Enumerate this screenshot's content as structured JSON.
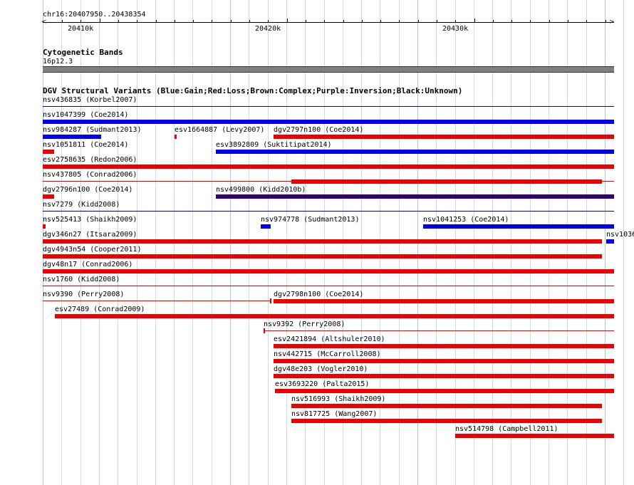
{
  "ruler": {
    "location": "chr16:20407950..20438354",
    "labels": [
      "20410k",
      "20420k",
      "20430k"
    ]
  },
  "cytoband": {
    "title": "Cytogenetic Bands",
    "band": "16p12.3"
  },
  "dgv": {
    "title": "DGV Structural Variants (Blue:Gain;Red:Loss;Brown:Complex;Purple:Inversion;Black:Unknown)",
    "colors": {
      "gain": "#0000ee",
      "loss": "#ee0000",
      "inversion": "#330077",
      "band": "#808080"
    },
    "features": [
      {
        "label": "nsv436835 (Korbel2007)"
      },
      {
        "label": "nsv1047399 (Coe2014)"
      },
      {
        "label": "nsv984287 (Sudmant2013)"
      },
      {
        "label": "esv1664887 (Levy2007)"
      },
      {
        "label": "dgv2797n100 (Coe2014)"
      },
      {
        "label": "nsv1051811 (Coe2014)"
      },
      {
        "label": "esv3892809 (Suktitipat2014)"
      },
      {
        "label": "esv2758635 (Redon2006)"
      },
      {
        "label": "nsv437805 (Conrad2006)"
      },
      {
        "label": "dgv2796n100 (Coe2014)"
      },
      {
        "label": "nsv499800 (Kidd2010b)"
      },
      {
        "label": "nsv7279 (Kidd2008)"
      },
      {
        "label": "nsv525413 (Shaikh2009)"
      },
      {
        "label": "nsv974778 (Sudmant2013)"
      },
      {
        "label": "nsv1041253 (Coe2014)"
      },
      {
        "label": "dgv346n27 (Itsara2009)"
      },
      {
        "label": "nsv1036"
      },
      {
        "label": "dgv4943n54 (Cooper2011)"
      },
      {
        "label": "dgv48n17 (Conrad2006)"
      },
      {
        "label": "nsv1760 (Kidd2008)"
      },
      {
        "label": "nsv9390 (Perry2008)"
      },
      {
        "label": "dgv2798n100 (Coe2014)"
      },
      {
        "label": "esv27489 (Conrad2009)"
      },
      {
        "label": "nsv9392 (Perry2008)"
      },
      {
        "label": "esv2421894 (Altshuler2010)"
      },
      {
        "label": "nsv442715 (McCarroll2008)"
      },
      {
        "label": "dgv48e203 (Vogler2010)"
      },
      {
        "label": "esv3693220 (Palta2015)"
      },
      {
        "label": "nsv516993 (Shaikh2009)"
      },
      {
        "label": "nsv817725 (Wang2007)"
      },
      {
        "label": "nsv514798 (Campbell2011)"
      }
    ]
  }
}
